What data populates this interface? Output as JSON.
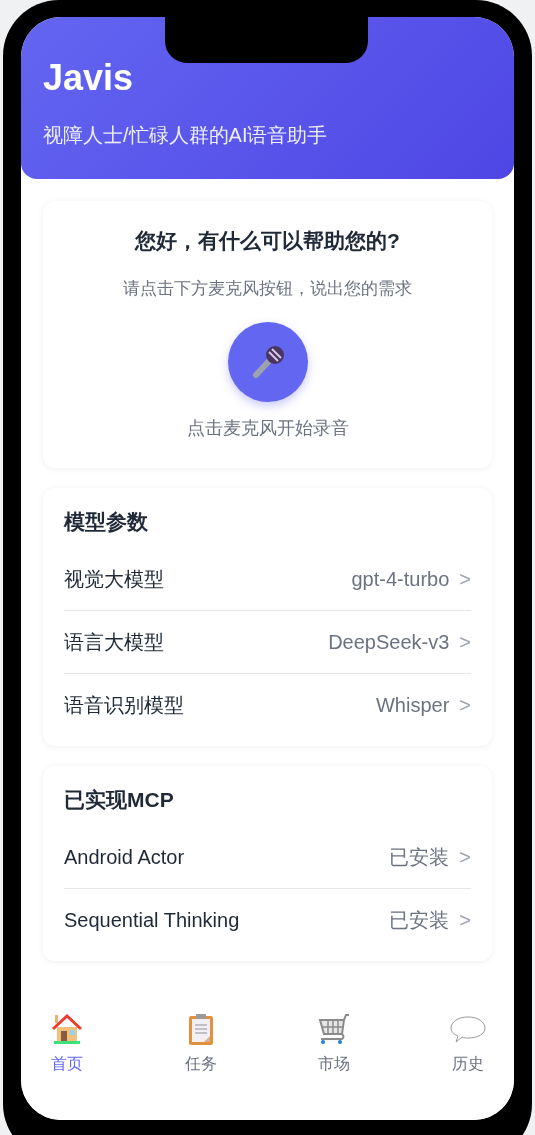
{
  "header": {
    "title": "Javis",
    "subtitle": "视障人士/忙碌人群的AI语音助手"
  },
  "greeting_card": {
    "title": "您好，有什么可以帮助您的?",
    "hint": "请点击下方麦克风按钮，说出您的需求",
    "mic_caption": "点击麦克风开始录音"
  },
  "sections": [
    {
      "title": "模型参数",
      "rows": [
        {
          "label": "视觉大模型",
          "value": "gpt-4-turbo",
          "chevron": ">"
        },
        {
          "label": "语言大模型",
          "value": "DeepSeek-v3",
          "chevron": ">"
        },
        {
          "label": "语音识别模型",
          "value": "Whisper",
          "chevron": ">"
        }
      ]
    },
    {
      "title": "已实现MCP",
      "rows": [
        {
          "label": "Android Actor",
          "value": "已安装",
          "chevron": ">"
        },
        {
          "label": "Sequential Thinking",
          "value": "已安装",
          "chevron": ">"
        }
      ]
    }
  ],
  "nav": [
    {
      "label": "首页",
      "kind": "home",
      "selected": true
    },
    {
      "label": "任务",
      "kind": "clipboard",
      "selected": false
    },
    {
      "label": "市场",
      "kind": "cart",
      "selected": false
    },
    {
      "label": "历史",
      "kind": "chat",
      "selected": false
    }
  ]
}
